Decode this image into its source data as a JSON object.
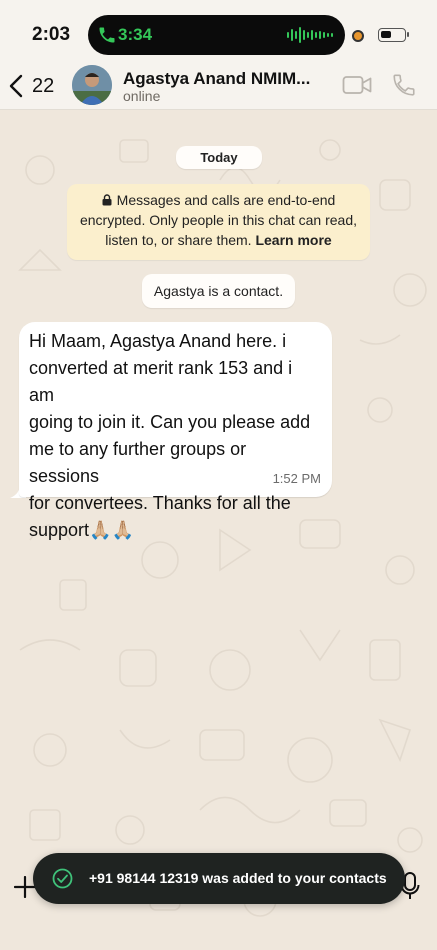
{
  "status_bar": {
    "time": "2:03",
    "call_timer": "3:34",
    "call_color": "#34c759"
  },
  "header": {
    "back_count": "22",
    "contact_name": "Agastya Anand NMIM...",
    "contact_status": "online"
  },
  "chat": {
    "date_label": "Today",
    "encryption_notice": "Messages and calls are end-to-end encrypted. Only people in this chat can read, listen to, or share them.",
    "encryption_link": "Learn more",
    "contact_notice": "Agastya is a contact.",
    "message": {
      "lines": [
        "Hi Maam, Agastya Anand here. i",
        "converted at merit rank 153 and i am",
        "going to join it. Can you please add",
        "me to any further groups or sessions",
        "for convertees. Thanks for all the",
        "support🙏🏼🙏🏼"
      ],
      "time": "1:52 PM"
    }
  },
  "toast": {
    "text": "+91 98144 12319 was added to your contacts",
    "icon": "check-circle-icon",
    "icon_color": "#3fc27a"
  },
  "colors": {
    "chat_background": "#efe7dc",
    "encryption_bg": "#fbefcd",
    "bubble_bg": "#ffffff",
    "toast_bg": "#1f2321"
  }
}
